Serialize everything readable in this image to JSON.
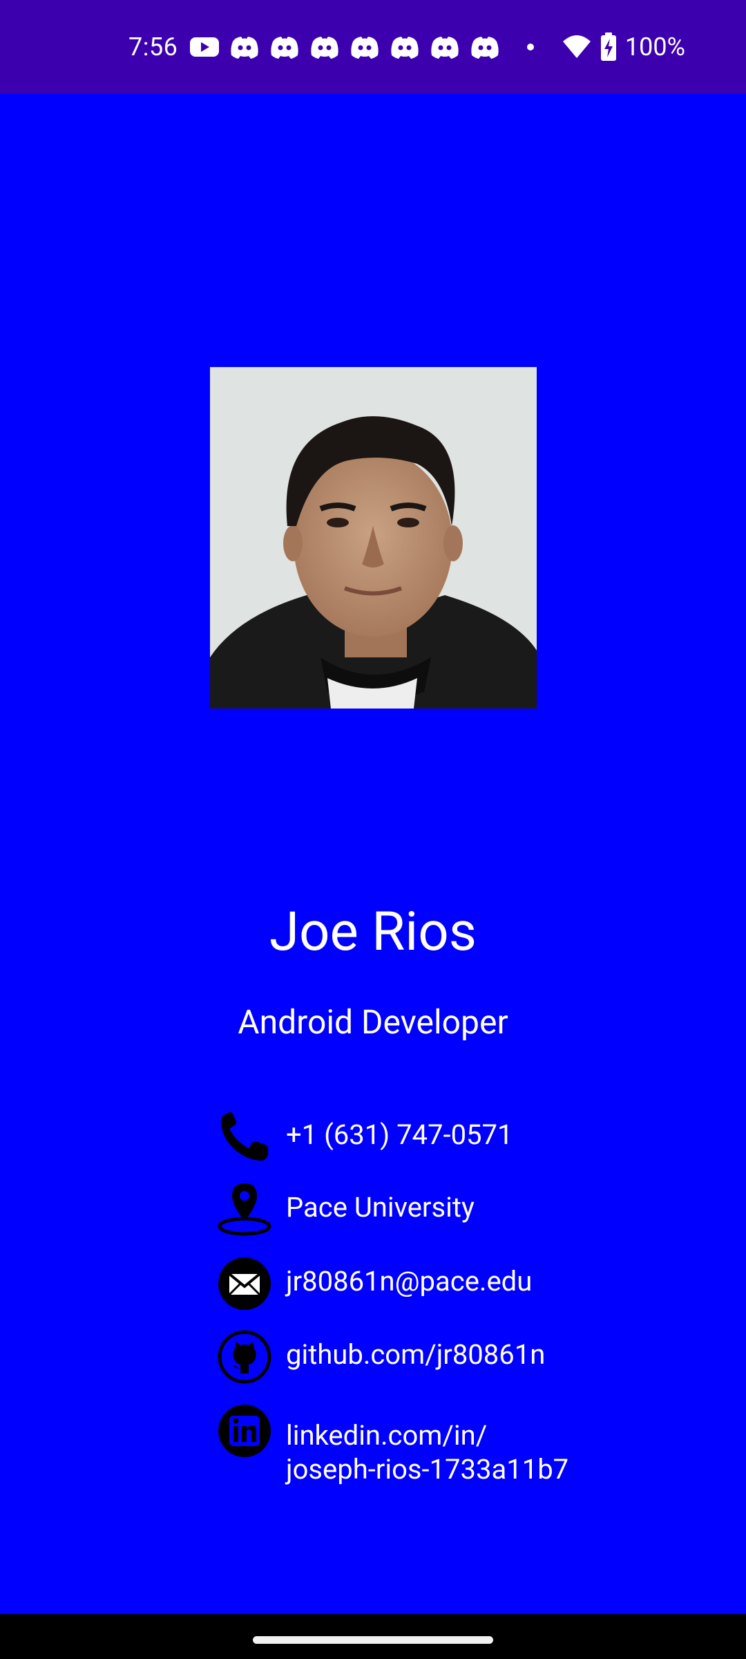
{
  "status_bar": {
    "time": "7:56",
    "battery": "100%",
    "background_color": "#3D00AF",
    "icons": [
      "youtube-icon",
      "discord-icon",
      "discord-icon",
      "discord-icon",
      "discord-icon",
      "discord-icon",
      "discord-icon",
      "discord-icon",
      "dot-icon",
      "wifi-icon",
      "battery-charging-icon"
    ]
  },
  "screen": {
    "background_color": "#0000FF"
  },
  "profile": {
    "name": "Joe Rios",
    "title": "Android Developer"
  },
  "contacts": [
    {
      "icon": "phone-icon",
      "text": "+1 (631) 747-0571"
    },
    {
      "icon": "location-pin-icon",
      "text": "Pace University"
    },
    {
      "icon": "email-icon",
      "text": "jr80861n@pace.edu"
    },
    {
      "icon": "github-icon",
      "text": "github.com/jr80861n"
    },
    {
      "icon": "linkedin-icon",
      "text_line1": "linkedin.com/in/",
      "text_line2": "joseph-rios-1733a11b7"
    }
  ]
}
